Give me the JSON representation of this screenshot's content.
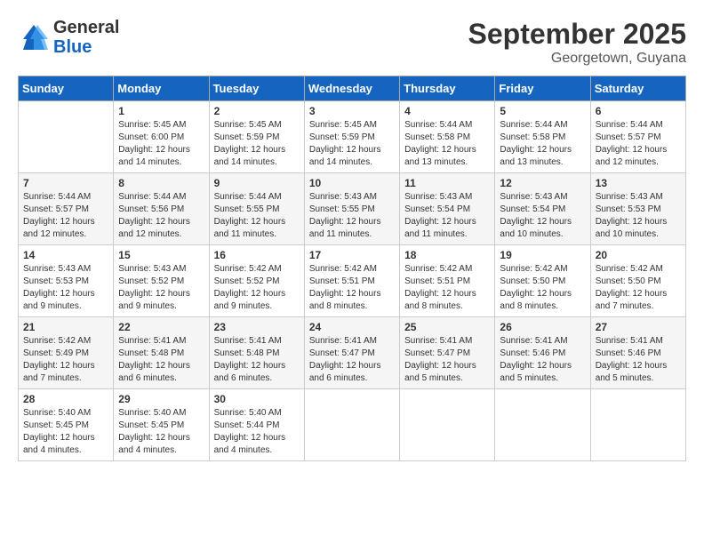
{
  "header": {
    "logo_general": "General",
    "logo_blue": "Blue",
    "month": "September 2025",
    "location": "Georgetown, Guyana"
  },
  "days_of_week": [
    "Sunday",
    "Monday",
    "Tuesday",
    "Wednesday",
    "Thursday",
    "Friday",
    "Saturday"
  ],
  "weeks": [
    [
      {
        "num": "",
        "info": ""
      },
      {
        "num": "1",
        "info": "Sunrise: 5:45 AM\nSunset: 6:00 PM\nDaylight: 12 hours\nand 14 minutes."
      },
      {
        "num": "2",
        "info": "Sunrise: 5:45 AM\nSunset: 5:59 PM\nDaylight: 12 hours\nand 14 minutes."
      },
      {
        "num": "3",
        "info": "Sunrise: 5:45 AM\nSunset: 5:59 PM\nDaylight: 12 hours\nand 14 minutes."
      },
      {
        "num": "4",
        "info": "Sunrise: 5:44 AM\nSunset: 5:58 PM\nDaylight: 12 hours\nand 13 minutes."
      },
      {
        "num": "5",
        "info": "Sunrise: 5:44 AM\nSunset: 5:58 PM\nDaylight: 12 hours\nand 13 minutes."
      },
      {
        "num": "6",
        "info": "Sunrise: 5:44 AM\nSunset: 5:57 PM\nDaylight: 12 hours\nand 12 minutes."
      }
    ],
    [
      {
        "num": "7",
        "info": "Sunrise: 5:44 AM\nSunset: 5:57 PM\nDaylight: 12 hours\nand 12 minutes."
      },
      {
        "num": "8",
        "info": "Sunrise: 5:44 AM\nSunset: 5:56 PM\nDaylight: 12 hours\nand 12 minutes."
      },
      {
        "num": "9",
        "info": "Sunrise: 5:44 AM\nSunset: 5:55 PM\nDaylight: 12 hours\nand 11 minutes."
      },
      {
        "num": "10",
        "info": "Sunrise: 5:43 AM\nSunset: 5:55 PM\nDaylight: 12 hours\nand 11 minutes."
      },
      {
        "num": "11",
        "info": "Sunrise: 5:43 AM\nSunset: 5:54 PM\nDaylight: 12 hours\nand 11 minutes."
      },
      {
        "num": "12",
        "info": "Sunrise: 5:43 AM\nSunset: 5:54 PM\nDaylight: 12 hours\nand 10 minutes."
      },
      {
        "num": "13",
        "info": "Sunrise: 5:43 AM\nSunset: 5:53 PM\nDaylight: 12 hours\nand 10 minutes."
      }
    ],
    [
      {
        "num": "14",
        "info": "Sunrise: 5:43 AM\nSunset: 5:53 PM\nDaylight: 12 hours\nand 9 minutes."
      },
      {
        "num": "15",
        "info": "Sunrise: 5:43 AM\nSunset: 5:52 PM\nDaylight: 12 hours\nand 9 minutes."
      },
      {
        "num": "16",
        "info": "Sunrise: 5:42 AM\nSunset: 5:52 PM\nDaylight: 12 hours\nand 9 minutes."
      },
      {
        "num": "17",
        "info": "Sunrise: 5:42 AM\nSunset: 5:51 PM\nDaylight: 12 hours\nand 8 minutes."
      },
      {
        "num": "18",
        "info": "Sunrise: 5:42 AM\nSunset: 5:51 PM\nDaylight: 12 hours\nand 8 minutes."
      },
      {
        "num": "19",
        "info": "Sunrise: 5:42 AM\nSunset: 5:50 PM\nDaylight: 12 hours\nand 8 minutes."
      },
      {
        "num": "20",
        "info": "Sunrise: 5:42 AM\nSunset: 5:50 PM\nDaylight: 12 hours\nand 7 minutes."
      }
    ],
    [
      {
        "num": "21",
        "info": "Sunrise: 5:42 AM\nSunset: 5:49 PM\nDaylight: 12 hours\nand 7 minutes."
      },
      {
        "num": "22",
        "info": "Sunrise: 5:41 AM\nSunset: 5:48 PM\nDaylight: 12 hours\nand 6 minutes."
      },
      {
        "num": "23",
        "info": "Sunrise: 5:41 AM\nSunset: 5:48 PM\nDaylight: 12 hours\nand 6 minutes."
      },
      {
        "num": "24",
        "info": "Sunrise: 5:41 AM\nSunset: 5:47 PM\nDaylight: 12 hours\nand 6 minutes."
      },
      {
        "num": "25",
        "info": "Sunrise: 5:41 AM\nSunset: 5:47 PM\nDaylight: 12 hours\nand 5 minutes."
      },
      {
        "num": "26",
        "info": "Sunrise: 5:41 AM\nSunset: 5:46 PM\nDaylight: 12 hours\nand 5 minutes."
      },
      {
        "num": "27",
        "info": "Sunrise: 5:41 AM\nSunset: 5:46 PM\nDaylight: 12 hours\nand 5 minutes."
      }
    ],
    [
      {
        "num": "28",
        "info": "Sunrise: 5:40 AM\nSunset: 5:45 PM\nDaylight: 12 hours\nand 4 minutes."
      },
      {
        "num": "29",
        "info": "Sunrise: 5:40 AM\nSunset: 5:45 PM\nDaylight: 12 hours\nand 4 minutes."
      },
      {
        "num": "30",
        "info": "Sunrise: 5:40 AM\nSunset: 5:44 PM\nDaylight: 12 hours\nand 4 minutes."
      },
      {
        "num": "",
        "info": ""
      },
      {
        "num": "",
        "info": ""
      },
      {
        "num": "",
        "info": ""
      },
      {
        "num": "",
        "info": ""
      }
    ]
  ]
}
